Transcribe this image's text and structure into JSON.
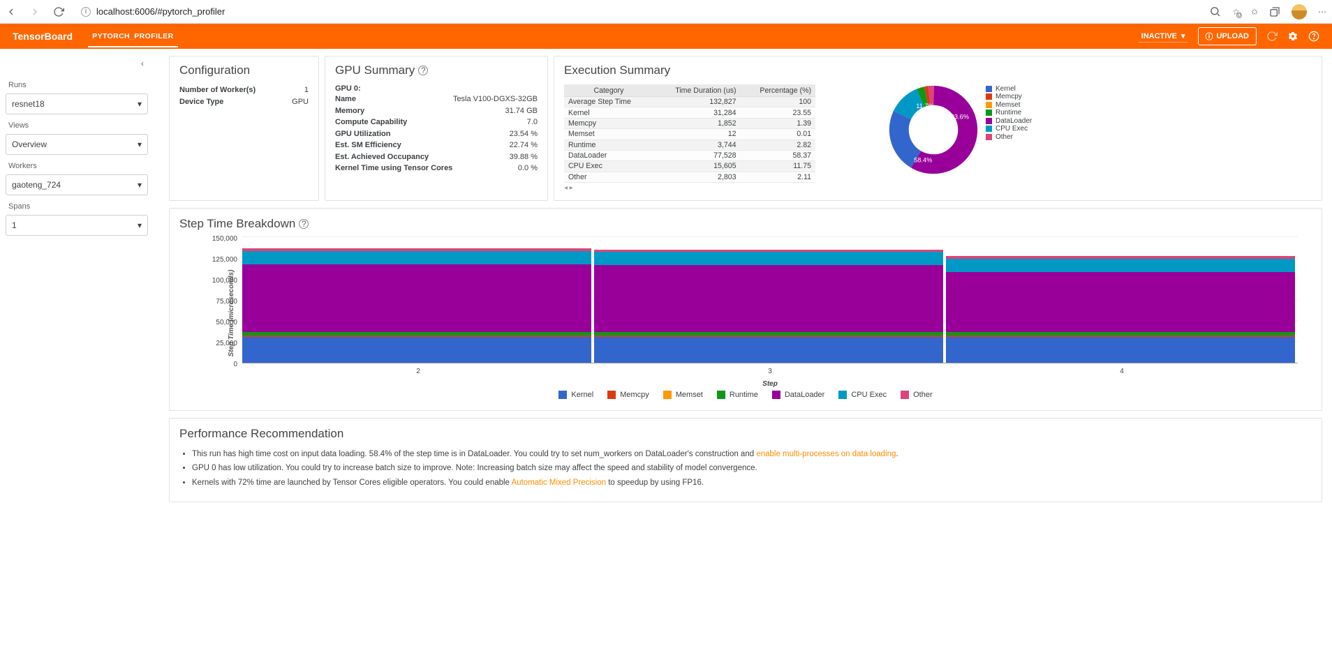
{
  "browser": {
    "url": "localhost:6006/#pytorch_profiler"
  },
  "header": {
    "app_title": "TensorBoard",
    "tab": "PYTORCH_PROFILER",
    "inactive": "INACTIVE",
    "upload": "UPLOAD"
  },
  "sidebar": {
    "runs_label": "Runs",
    "runs_value": "resnet18",
    "views_label": "Views",
    "views_value": "Overview",
    "workers_label": "Workers",
    "workers_value": "gaoteng_724",
    "spans_label": "Spans",
    "spans_value": "1"
  },
  "config": {
    "title": "Configuration",
    "rows": [
      {
        "k": "Number of Worker(s)",
        "v": "1"
      },
      {
        "k": "Device Type",
        "v": "GPU"
      }
    ]
  },
  "gpu": {
    "title": "GPU Summary",
    "head": "GPU 0:",
    "rows": [
      {
        "k": "Name",
        "v": "Tesla V100-DGXS-32GB"
      },
      {
        "k": "Memory",
        "v": "31.74 GB"
      },
      {
        "k": "Compute Capability",
        "v": "7.0"
      },
      {
        "k": "GPU Utilization",
        "v": "23.54 %"
      },
      {
        "k": "Est. SM Efficiency",
        "v": "22.74 %"
      },
      {
        "k": "Est. Achieved Occupancy",
        "v": "39.88 %"
      },
      {
        "k": "Kernel Time using Tensor Cores",
        "v": "0.0 %"
      }
    ]
  },
  "exec": {
    "title": "Execution Summary",
    "h1": "Category",
    "h2": "Time Duration (us)",
    "h3": "Percentage (%)",
    "rows": [
      {
        "c": "Average Step Time",
        "t": "132,827",
        "p": "100"
      },
      {
        "c": "Kernel",
        "t": "31,284",
        "p": "23.55"
      },
      {
        "c": "Memcpy",
        "t": "1,852",
        "p": "1.39"
      },
      {
        "c": "Memset",
        "t": "12",
        "p": "0.01"
      },
      {
        "c": "Runtime",
        "t": "3,744",
        "p": "2.82"
      },
      {
        "c": "DataLoader",
        "t": "77,528",
        "p": "58.37"
      },
      {
        "c": "CPU Exec",
        "t": "15,605",
        "p": "11.75"
      },
      {
        "c": "Other",
        "t": "2,803",
        "p": "2.11"
      }
    ],
    "donut_labels": {
      "a": "23.6%",
      "b": "11.7%",
      "c": "58.4%"
    },
    "legend": [
      "Kernel",
      "Memcpy",
      "Memset",
      "Runtime",
      "DataLoader",
      "CPU Exec",
      "Other"
    ]
  },
  "colors": {
    "Kernel": "#3366cc",
    "Memcpy": "#dc3912",
    "Memset": "#ff9900",
    "Runtime": "#109618",
    "DataLoader": "#990099",
    "CPU Exec": "#0099c6",
    "Other": "#dd4477"
  },
  "step": {
    "title": "Step Time Breakdown",
    "ylabel": "Step Time (microseconds)",
    "xlabel": "Step",
    "legend": [
      "Kernel",
      "Memcpy",
      "Memset",
      "Runtime",
      "DataLoader",
      "CPU Exec",
      "Other"
    ]
  },
  "chart_data": {
    "type": "bar",
    "x": [
      2,
      3,
      4
    ],
    "series": [
      {
        "name": "Kernel",
        "values": [
          31000,
          31000,
          31000
        ]
      },
      {
        "name": "Memcpy",
        "values": [
          1900,
          1900,
          1900
        ]
      },
      {
        "name": "Memset",
        "values": [
          12,
          12,
          12
        ]
      },
      {
        "name": "Runtime",
        "values": [
          3700,
          3700,
          3700
        ]
      },
      {
        "name": "DataLoader",
        "values": [
          81000,
          80000,
          72000
        ]
      },
      {
        "name": "CPU Exec",
        "values": [
          16000,
          16000,
          16000
        ]
      },
      {
        "name": "Other",
        "values": [
          2800,
          2800,
          2800
        ]
      }
    ],
    "ylim": [
      0,
      150000
    ],
    "yticks": [
      0,
      25000,
      50000,
      75000,
      100000,
      125000,
      150000
    ],
    "ytick_labels": [
      "0",
      "25,000",
      "50,000",
      "75,000",
      "100,000",
      "125,000",
      "150,000"
    ]
  },
  "rec": {
    "title": "Performance Recommendation",
    "items": [
      {
        "pre": "This run has high time cost on input data loading. 58.4% of the step time is in DataLoader. You could try to set num_workers on DataLoader's construction and ",
        "link": "enable multi-processes on data loading",
        "post": "."
      },
      {
        "pre": "GPU 0 has low utilization. You could try to increase batch size to improve. Note: Increasing batch size may affect the speed and stability of model convergence.",
        "link": "",
        "post": ""
      },
      {
        "pre": "Kernels with 72% time are launched by Tensor Cores eligible operators. You could enable ",
        "link": "Automatic Mixed Precision",
        "post": " to speedup by using FP16."
      }
    ]
  }
}
